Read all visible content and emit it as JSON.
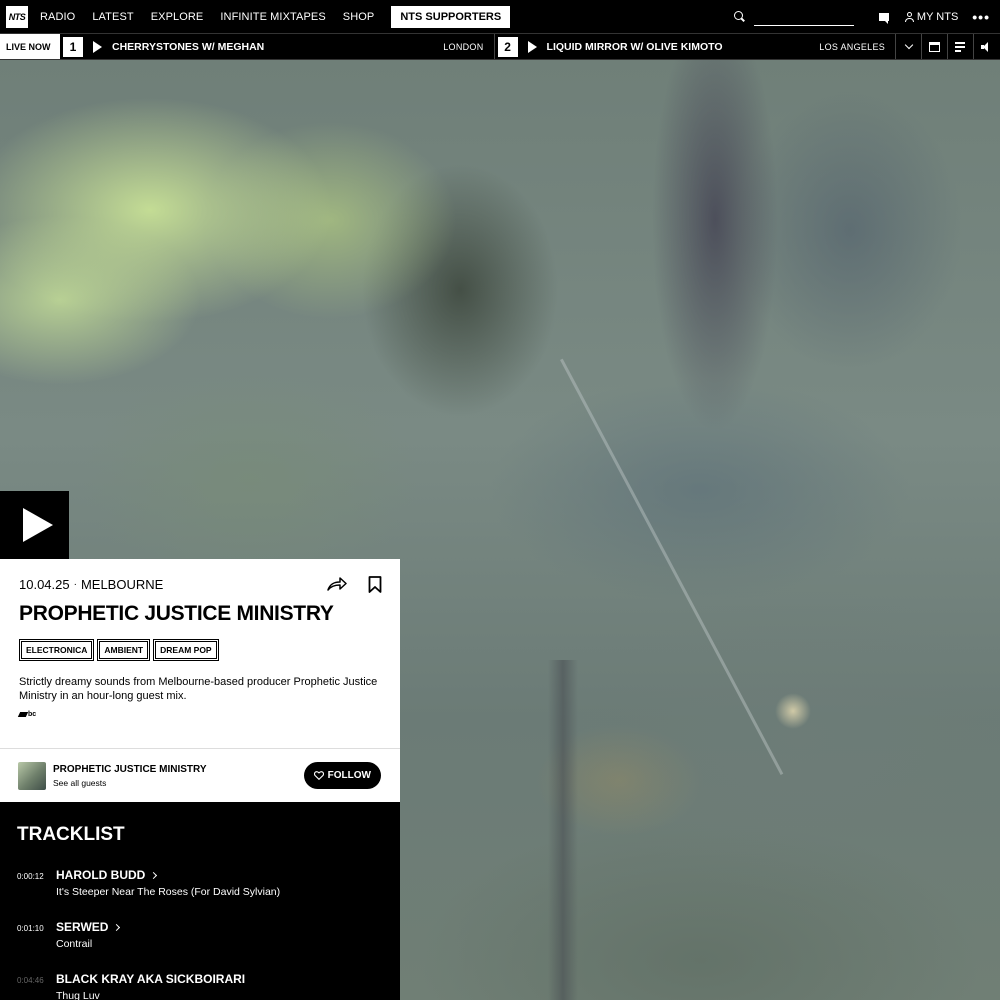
{
  "topnav": {
    "logo_text": "NTS",
    "items": [
      "RADIO",
      "LATEST",
      "EXPLORE",
      "INFINITE MIXTAPES",
      "SHOP"
    ],
    "supporters_label": "NTS SUPPORTERS",
    "search_placeholder": "",
    "my_nts_label": "MY NTS",
    "more_label": "•••"
  },
  "livebar": {
    "live_label": "LIVE NOW",
    "channels": [
      {
        "number": "1",
        "title": "CHERRYSTONES W/ MEGHAN",
        "location": "LONDON"
      },
      {
        "number": "2",
        "title": "LIQUID MIRROR W/ OLIVE KIMOTO",
        "location": "LOS ANGELES"
      }
    ]
  },
  "episode": {
    "date": "10.04.25",
    "separator": "·",
    "location": "MELBOURNE",
    "title": "PROPHETIC JUSTICE MINISTRY",
    "tags": [
      "ELECTRONICA",
      "AMBIENT",
      "DREAM POP"
    ],
    "description": "Strictly dreamy sounds from Melbourne-based producer Prophetic Justice Ministry in an hour-long guest mix.",
    "bc_label": "bc"
  },
  "host": {
    "name": "PROPHETIC JUSTICE MINISTRY",
    "subtitle": "See all guests",
    "follow_label": "FOLLOW"
  },
  "tracklist": {
    "title": "TRACKLIST",
    "tracks": [
      {
        "time": "0:00:12",
        "artist": "HAROLD BUDD",
        "song": "It's Steeper Near The Roses (For David Sylvian)"
      },
      {
        "time": "0:01:10",
        "artist": "SERWED",
        "song": "Contrail"
      },
      {
        "time": "0:04:46",
        "artist": "BLACK KRAY AKA SICKBOIRARI",
        "song": "Thug Luv"
      }
    ]
  },
  "colors": {
    "live_dot": "#e02020",
    "accent": "#ffffff",
    "background": "#000000"
  },
  "icons": [
    "search-icon",
    "chat-icon",
    "user-icon",
    "play-icon",
    "chevron-down-icon",
    "calendar-icon",
    "queue-icon",
    "volume-icon",
    "share-icon",
    "bookmark-icon",
    "heart-icon",
    "chevron-right-icon"
  ]
}
